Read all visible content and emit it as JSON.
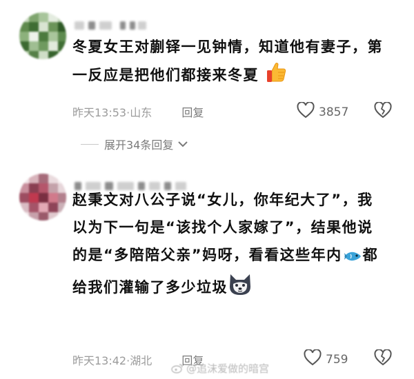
{
  "comments": [
    {
      "text": "冬夏女王对蒯铎一见钟情，知道他有妻子，第一反应是把他们都接来冬夏",
      "emoji": "thumbs-up-icon",
      "time": "昨天13:53",
      "location": "山东",
      "reply_label": "回复",
      "likes": "3857",
      "expand_label": "展开34条回复"
    },
    {
      "text_before_emoji": "赵秉文对八公子说“女儿，你年纪大了”，我以为下一句是“该找个人家嫁了”，结果他说的是“多陪陪父亲”妈呀，看看这些年内",
      "inline_emoji": "fish-icon",
      "text_after_emoji": "都给我们灌输了多少垃圾",
      "end_emoji": "husky-dog-icon",
      "time": "昨天13:42",
      "location": "湖北",
      "reply_label": "回复",
      "likes": "759"
    }
  ],
  "watermark": "@追沫爱做的暗宫",
  "colors": {
    "meta_gray": "#9b9b9b",
    "text": "#111111",
    "background": "#ffffff"
  }
}
